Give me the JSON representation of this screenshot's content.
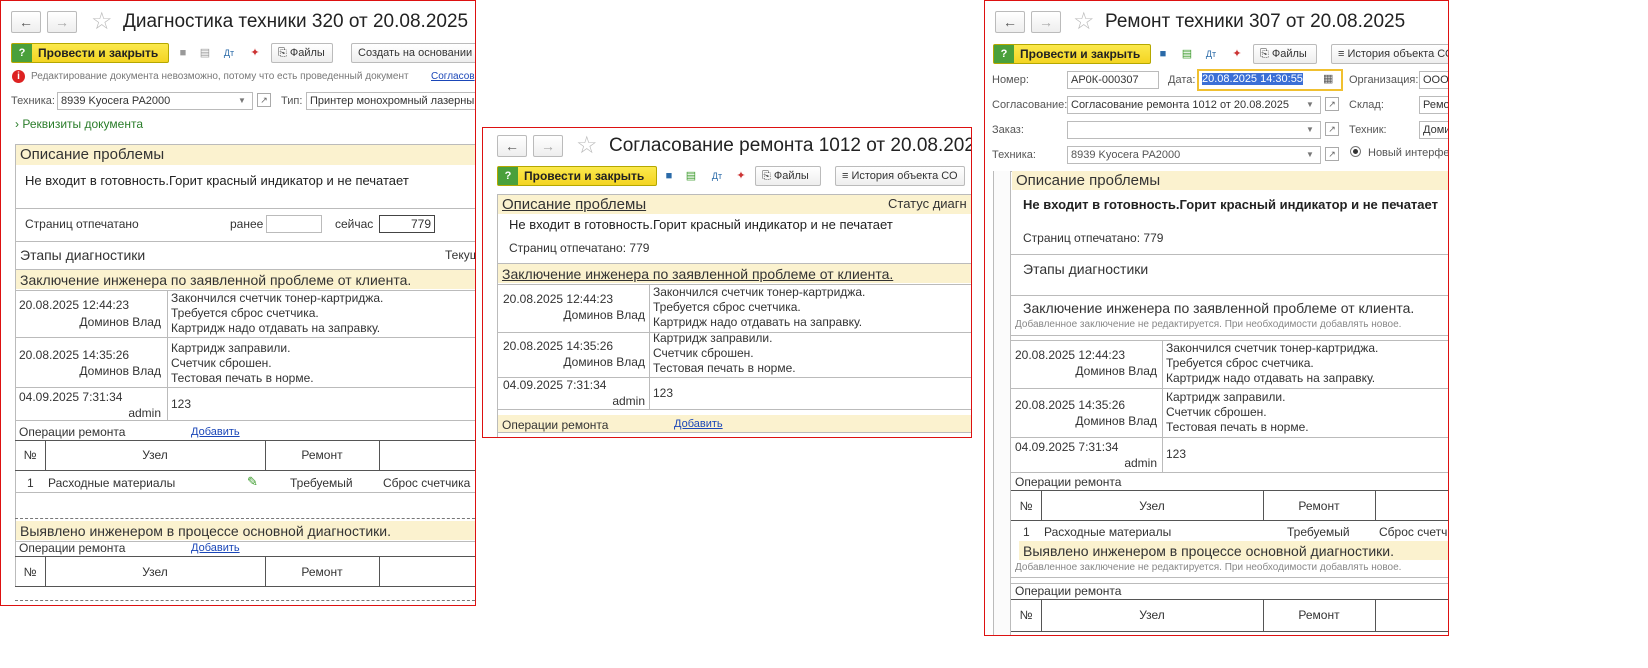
{
  "common": {
    "problem_desc_header": "Описание проблемы",
    "problem_text": "Не входит в готовность.Горит красный индикатор и не печатает",
    "pages_printed_label": "Страниц отпечатано",
    "pages_before_label": "ранее",
    "pages_now_label": "сейчас",
    "pages_now_value": "779",
    "pages_printed_full": "Страниц отпечатано: 779",
    "diag_stages": "Этапы диагностики",
    "conclusion_header": "Заключение инженера по заявленной проблеме от клиента.",
    "found_header": "Выявлено инженером в процессе основной диагностики.",
    "no_edit_note": "Добавленное заключение не редактируется. При необходимости добавлять новое.",
    "ops_label": "Операции ремонта",
    "add_link": "Добавить",
    "col_num": "№",
    "col_node": "Узел",
    "col_repair": "Ремонт",
    "entries": [
      {
        "date": "20.08.2025 12:44:23",
        "author": "Доминов Влад",
        "lines": [
          "Закончился счетчик тонер-картриджа.",
          "Требуется сброс счетчика.",
          "Картридж надо отдавать на заправку."
        ]
      },
      {
        "date": "20.08.2025 14:35:26",
        "author": "Доминов Влад",
        "lines": [
          "Картридж заправили.",
          "Счетчик сброшен.",
          "Тестовая печать в норме."
        ]
      },
      {
        "date": "04.09.2025 7:31:34",
        "author": "admin",
        "lines": [
          "123"
        ]
      }
    ],
    "op_row": {
      "num": "1",
      "node": "Расходные материалы",
      "repair": "Требуемый",
      "op": "Сброс счетчика",
      "op_short": "Сброс счетч"
    },
    "files_btn": "Файлы",
    "post_close_btn": "Провести и закрыть",
    "history_btn": "История объекта СО",
    "history_btn_short": "История объекта СО",
    "back_icon": "arrow-left-icon",
    "forward_icon": "arrow-right-icon",
    "favorite_icon": "star-icon"
  },
  "w1": {
    "title": "Диагностика техники 320 от 20.08.2025",
    "create_based": "Создать на основании",
    "info_text": "Редактирование документа невозможно, потому что есть проведенный документ",
    "info_link": "Согласов",
    "tech_label": "Техника:",
    "tech_value": "8939 Kyocera PA2000",
    "type_label": "Тип:",
    "type_value": "Принтер монохромный лазерный А",
    "requisites": "Реквизиты документа",
    "current_label": "Текущ"
  },
  "w2": {
    "title": "Согласование ремонта 1012 от 20.08.2025",
    "status_label": "Статус диагн"
  },
  "w3": {
    "title": "Ремонт техники 307 от 20.08.2025",
    "number_label": "Номер:",
    "number_value": "АР0К-000307",
    "date_label": "Дата:",
    "date_value": "20.08.2025 14:30:55",
    "org_label": "Организация:",
    "org_value": "ООО",
    "approval_label": "Согласование:",
    "approval_value": "Согласование ремонта 1012 от 20.08.2025",
    "warehouse_label": "Склад:",
    "warehouse_value": "Ремон",
    "order_label": "Заказ:",
    "order_value": "",
    "technician_label": "Техник:",
    "technician_value": "Доми",
    "tech_label": "Техника:",
    "tech_value": "8939 Kyocera PA2000",
    "new_interface": "Новый интерфей"
  }
}
